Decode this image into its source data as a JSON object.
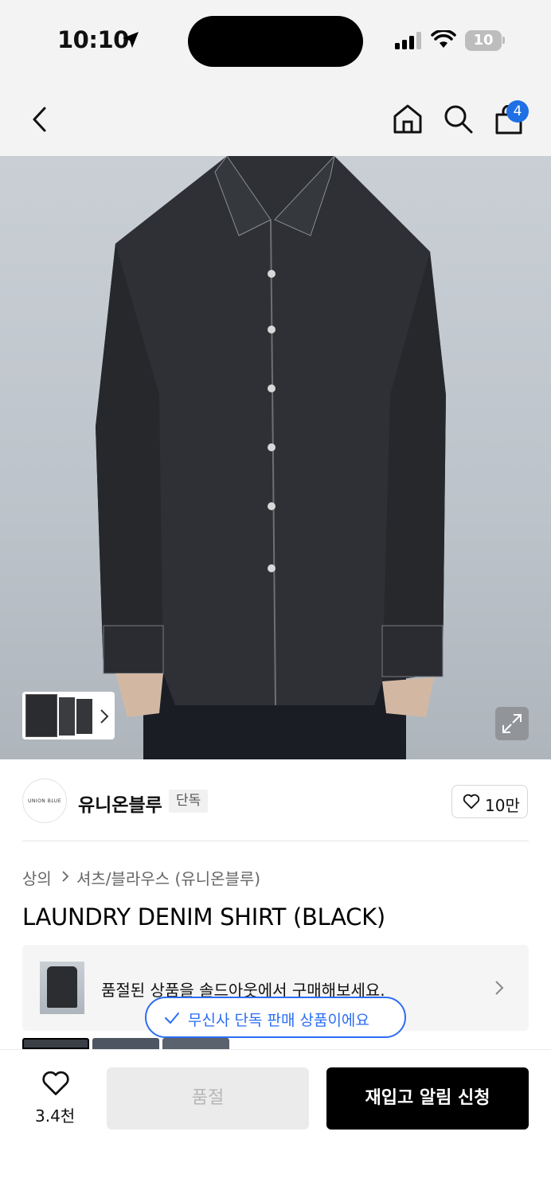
{
  "status_bar": {
    "time": "10:10",
    "battery": "10"
  },
  "header": {
    "cart_count": "4",
    "icons": [
      "back-icon",
      "home-icon",
      "search-icon",
      "shopping-bag-icon"
    ]
  },
  "brand": {
    "logo_text": "UNION BLUE",
    "name": "유니온블루",
    "badge": "단독",
    "like_count": "10만"
  },
  "breadcrumb": {
    "category": "상의",
    "subcategory": "셔츠/블라우스 (유니온블루)"
  },
  "product": {
    "title": "LAUNDRY DENIM SHIRT (BLACK)"
  },
  "soldout_banner": {
    "text": "품절된 상품을 솔드아웃에서 구매해보세요."
  },
  "exclusive_pill": {
    "text": "무신사 단독 판매 상품이에요"
  },
  "bottom_bar": {
    "wish_count": "3.4천",
    "soldout_label": "품절",
    "restock_label": "재입고 알림 신청"
  },
  "colors": {
    "accent_blue": "#2a6df4",
    "badge_blue": "#1f6fe5",
    "primary_black": "#000000"
  }
}
